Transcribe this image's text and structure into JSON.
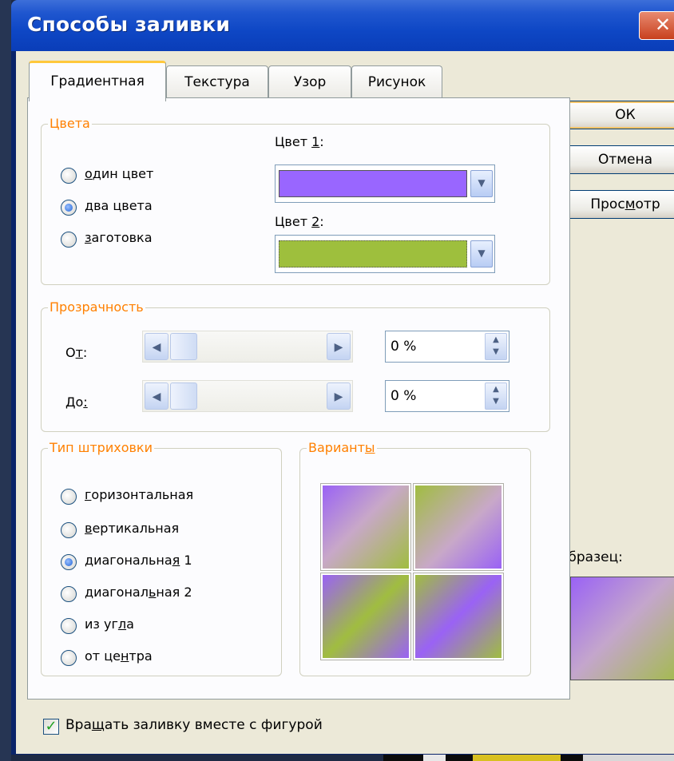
{
  "dialog": {
    "title": "Способы заливки",
    "close_glyph": "✕"
  },
  "tabs": [
    {
      "label": "Градиентная",
      "active": true
    },
    {
      "label": "Текстура",
      "active": false
    },
    {
      "label": "Узор",
      "active": false
    },
    {
      "label": "Рисунок",
      "active": false
    }
  ],
  "colors_group": {
    "title": "Цвета",
    "options": [
      "один цвет",
      "два цвета",
      "заготовка"
    ],
    "selected": "два цвета",
    "color1_label": "Цвет 1:",
    "color1_value": "#9966ff",
    "color2_label": "Цвет 2:",
    "color2_value": "#9ebf3d"
  },
  "transparency_group": {
    "title": "Прозрачность",
    "from_label": "От:",
    "from_value": "0 %",
    "to_label": "До:",
    "to_value": "0 %"
  },
  "shading_group": {
    "title": "Тип штриховки",
    "options": [
      "горизонтальная",
      "вертикальная",
      "диагональная 1",
      "диагональная 2",
      "из угла",
      "от центра"
    ],
    "selected": "диагональная 1"
  },
  "variants_group": {
    "title": "Варианты"
  },
  "buttons": {
    "ok": "ОК",
    "cancel": "Отмена",
    "preview": "Просмотр"
  },
  "sample": {
    "label": "Образец:"
  },
  "rotate_checkbox": {
    "label": "Вращать заливку вместе с фигурой",
    "checked": true
  },
  "icons": {
    "close": "close-icon",
    "dropdown": "chevron-down-icon",
    "scroll_left": "arrow-left-icon",
    "scroll_right": "arrow-right-icon",
    "spin": "spin-updown-icon",
    "check": "checkmark-icon"
  }
}
